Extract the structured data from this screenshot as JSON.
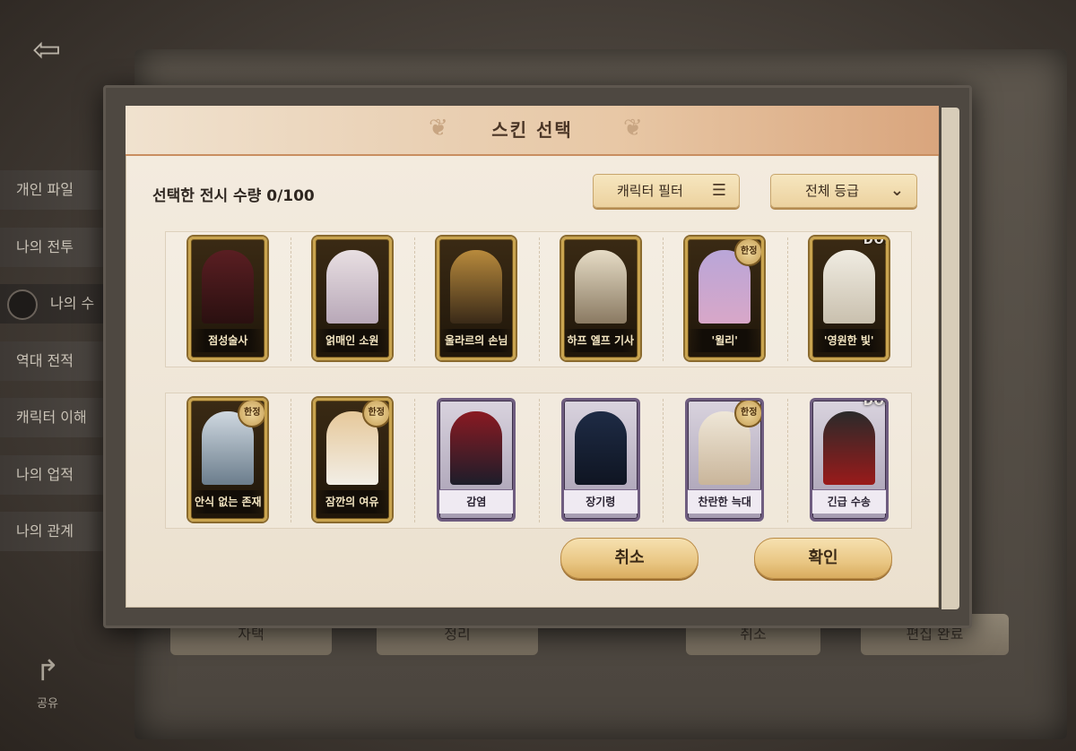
{
  "background": {
    "side_menu": [
      "개인 파일",
      "나의 전투",
      "나의 수",
      "역대 전적",
      "캐릭터 이해",
      "나의 업적",
      "나의 관계"
    ],
    "share_label": "공유",
    "bottom_buttons": [
      "자택",
      "정리",
      "취소",
      "편집 완료"
    ]
  },
  "modal": {
    "title": "스킨 선택",
    "count_label": "선택한 전시 수량 0/100",
    "character_filter": "캐릭터 필터",
    "grade_filter": "전체 등급",
    "cancel": "취소",
    "confirm": "확인"
  },
  "skins_row1": [
    {
      "name": "점성술사",
      "frame": "gold",
      "badge": "",
      "logo": "",
      "colors": [
        "#5a1e22",
        "#2a1010"
      ]
    },
    {
      "name": "얽매인 소원",
      "frame": "gold",
      "badge": "",
      "logo": "",
      "colors": [
        "#e8dfe2",
        "#b8a8b8"
      ]
    },
    {
      "name": "울라르의 손님",
      "frame": "gold",
      "badge": "",
      "logo": "",
      "colors": [
        "#b88a3c",
        "#3a2a18"
      ]
    },
    {
      "name": "하프 엘프 기사",
      "frame": "gold",
      "badge": "",
      "logo": "",
      "colors": [
        "#e6dcc6",
        "#8a7a62"
      ]
    },
    {
      "name": "'윌리'",
      "frame": "gold",
      "badge": "한정",
      "logo": "",
      "colors": [
        "#b9a6d8",
        "#d8a7c8"
      ]
    },
    {
      "name": "'영원한 빛'",
      "frame": "gold",
      "badge": "",
      "logo": "DOK",
      "colors": [
        "#f0ece2",
        "#c9c0ae"
      ]
    }
  ],
  "skins_row2": [
    {
      "name": "안식 없는 존재",
      "frame": "gold",
      "badge": "한정",
      "logo": "",
      "colors": [
        "#cfd8e0",
        "#6b7d8c"
      ]
    },
    {
      "name": "잠깐의 여유",
      "frame": "gold",
      "badge": "한정",
      "logo": "",
      "colors": [
        "#e6c89a",
        "#f2eee6"
      ]
    },
    {
      "name": "감염",
      "frame": "purple",
      "badge": "",
      "logo": "",
      "colors": [
        "#8a1a22",
        "#1d1d2a"
      ]
    },
    {
      "name": "장기령",
      "frame": "purple",
      "badge": "",
      "logo": "",
      "colors": [
        "#1e2b45",
        "#0f1522"
      ]
    },
    {
      "name": "찬란한 늑대",
      "frame": "purple",
      "badge": "한정",
      "logo": "",
      "colors": [
        "#efe7d8",
        "#c9b59a"
      ]
    },
    {
      "name": "긴급 수송",
      "frame": "purple",
      "badge": "",
      "logo": "DOK",
      "colors": [
        "#2a2a2a",
        "#9a1a1a"
      ]
    }
  ]
}
